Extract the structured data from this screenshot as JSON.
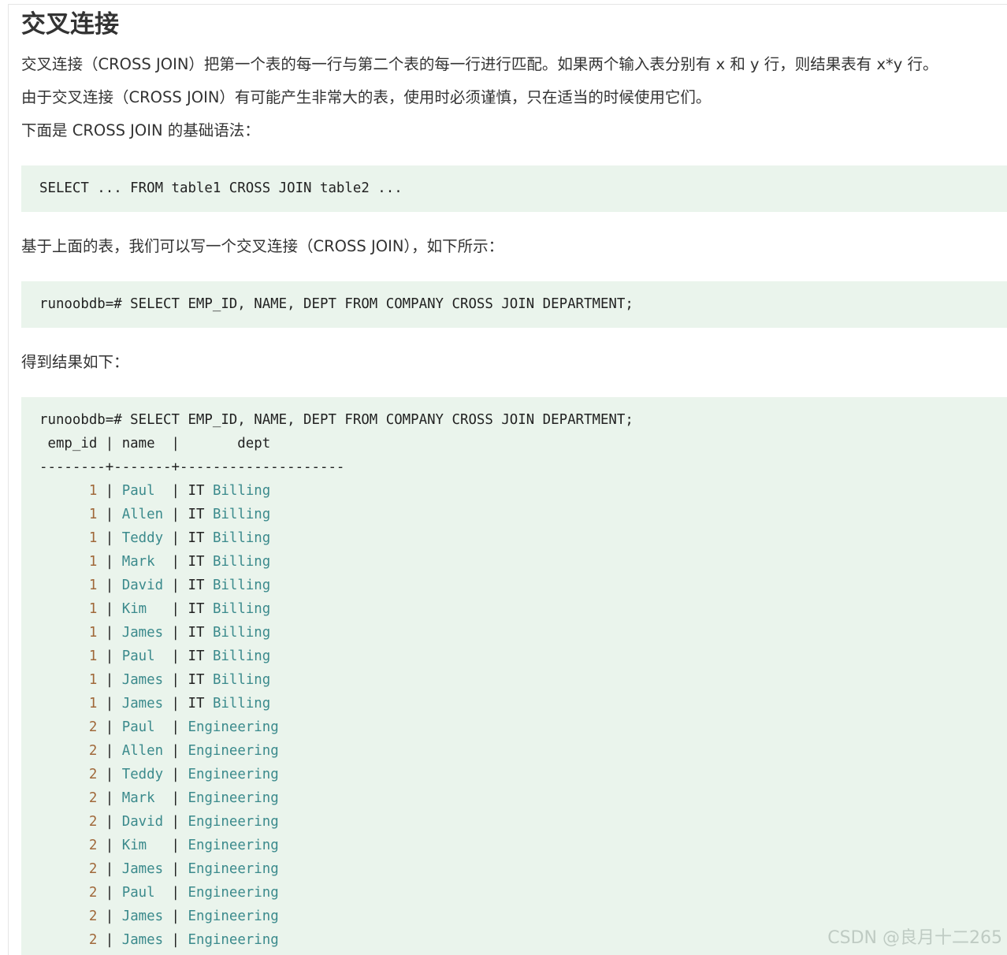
{
  "article": {
    "title": "交叉连接",
    "para1": "交叉连接（CROSS JOIN）把第一个表的每一行与第二个表的每一行进行匹配。如果两个输入表分别有 x 和 y 行，则结果表有 x*y 行。",
    "para2": "由于交叉连接（CROSS JOIN）有可能产生非常大的表，使用时必须谨慎，只在适当的时候使用它们。",
    "para3": "下面是 CROSS JOIN 的基础语法：",
    "syntax_code": "SELECT ... FROM table1 CROSS JOIN table2 ...",
    "para4": "基于上面的表，我们可以写一个交叉连接（CROSS JOIN），如下所示：",
    "query_code": "runoobdb=# SELECT EMP_ID, NAME, DEPT FROM COMPANY CROSS JOIN DEPARTMENT;",
    "para5": "得到结果如下：",
    "result": {
      "command": "runoobdb=# SELECT EMP_ID, NAME, DEPT FROM COMPANY CROSS JOIN DEPARTMENT;",
      "header": " emp_id | name  |       dept",
      "separator": "--------+-------+--------------------",
      "rows": [
        {
          "emp_id": "1",
          "name": "Paul",
          "dept_a": "IT",
          "dept_b": "Billing"
        },
        {
          "emp_id": "1",
          "name": "Allen",
          "dept_a": "IT",
          "dept_b": "Billing"
        },
        {
          "emp_id": "1",
          "name": "Teddy",
          "dept_a": "IT",
          "dept_b": "Billing"
        },
        {
          "emp_id": "1",
          "name": "Mark",
          "dept_a": "IT",
          "dept_b": "Billing"
        },
        {
          "emp_id": "1",
          "name": "David",
          "dept_a": "IT",
          "dept_b": "Billing"
        },
        {
          "emp_id": "1",
          "name": "Kim",
          "dept_a": "IT",
          "dept_b": "Billing"
        },
        {
          "emp_id": "1",
          "name": "James",
          "dept_a": "IT",
          "dept_b": "Billing"
        },
        {
          "emp_id": "1",
          "name": "Paul",
          "dept_a": "IT",
          "dept_b": "Billing"
        },
        {
          "emp_id": "1",
          "name": "James",
          "dept_a": "IT",
          "dept_b": "Billing"
        },
        {
          "emp_id": "1",
          "name": "James",
          "dept_a": "IT",
          "dept_b": "Billing"
        },
        {
          "emp_id": "2",
          "name": "Paul",
          "dept_a": "",
          "dept_b": "Engineering"
        },
        {
          "emp_id": "2",
          "name": "Allen",
          "dept_a": "",
          "dept_b": "Engineering"
        },
        {
          "emp_id": "2",
          "name": "Teddy",
          "dept_a": "",
          "dept_b": "Engineering"
        },
        {
          "emp_id": "2",
          "name": "Mark",
          "dept_a": "",
          "dept_b": "Engineering"
        },
        {
          "emp_id": "2",
          "name": "David",
          "dept_a": "",
          "dept_b": "Engineering"
        },
        {
          "emp_id": "2",
          "name": "Kim",
          "dept_a": "",
          "dept_b": "Engineering"
        },
        {
          "emp_id": "2",
          "name": "James",
          "dept_a": "",
          "dept_b": "Engineering"
        },
        {
          "emp_id": "2",
          "name": "Paul",
          "dept_a": "",
          "dept_b": "Engineering"
        },
        {
          "emp_id": "2",
          "name": "James",
          "dept_a": "",
          "dept_b": "Engineering"
        },
        {
          "emp_id": "2",
          "name": "James",
          "dept_a": "",
          "dept_b": "Engineering"
        }
      ]
    }
  },
  "watermark": "CSDN @良月十二265"
}
